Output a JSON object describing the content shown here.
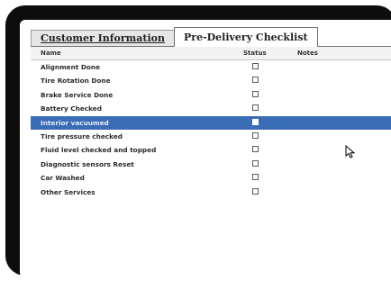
{
  "tabs": [
    {
      "label": "Customer Information",
      "active": false
    },
    {
      "label": "Pre-Delivery Checklist",
      "active": true
    }
  ],
  "columns": {
    "name": "Name",
    "status": "Status",
    "notes": "Notes"
  },
  "rows": [
    {
      "name": "Alignment Done",
      "checked": false
    },
    {
      "name": "Tire Rotation Done",
      "checked": false
    },
    {
      "name": "Brake Service Done",
      "checked": false
    },
    {
      "name": "Battery Checked",
      "checked": false
    },
    {
      "name": "Interior vacuumed",
      "checked": false,
      "selected": true
    },
    {
      "name": "Tire pressure checked",
      "checked": false
    },
    {
      "name": "Fluid level checked and topped",
      "checked": false
    },
    {
      "name": "Diagnostic sensors Reset",
      "checked": false
    },
    {
      "name": "Car Washed",
      "checked": false
    },
    {
      "name": "Other Services",
      "checked": false
    }
  ],
  "colors": {
    "selection": "#3b6db6",
    "frame": "#0d0d0d"
  },
  "icons": {
    "pointer": "mouse-pointer-icon"
  }
}
